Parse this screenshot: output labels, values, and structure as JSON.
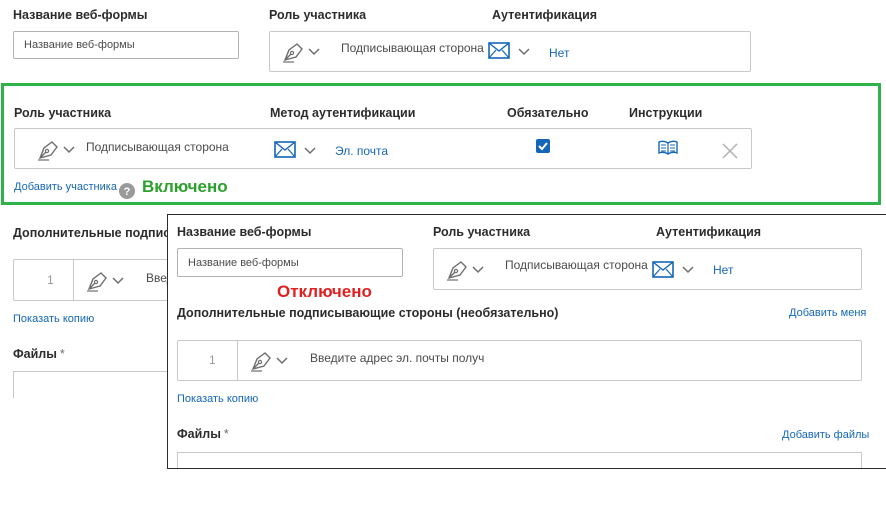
{
  "top": {
    "form_name_label": "Название веб-формы",
    "form_name_placeholder": "Название веб-формы",
    "role_label": "Роль участника",
    "auth_label": "Аутентификация",
    "role_value": "Подписывающая сторона",
    "auth_value": "Нет"
  },
  "enabled_panel": {
    "role_header": "Роль участника",
    "auth_method_header": "Метод аутентификации",
    "required_header": "Обязательно",
    "instructions_header": "Инструкции",
    "role_value": "Подписывающая сторона",
    "auth_value": "Эл. почта",
    "required_checked": true,
    "add_participant": "Добавить участника",
    "status_label": "Включено",
    "status_color": "#2ca02c",
    "border_color": "#2db34a"
  },
  "left_background": {
    "additional_signers_label": "Дополнительные подпис",
    "row_number": "1",
    "input_text": "Введ",
    "show_copy": "Показать копию",
    "files_label": "Файлы",
    "required_mark": "*"
  },
  "disabled_panel": {
    "form_name_label": "Название веб-формы",
    "form_name_placeholder": "Название веб-формы",
    "role_label": "Роль участника",
    "auth_label": "Аутентификация",
    "role_value": "Подписывающая сторона",
    "auth_value": "Нет",
    "status_label": "Отключено",
    "status_color": "#e02020",
    "additional_signers_label": "Дополнительные подписывающие стороны (необязательно)",
    "add_me": "Добавить меня",
    "row_number": "1",
    "email_placeholder": "Введите адрес эл. почты получ",
    "show_copy": "Показать копию",
    "files_label": "Файлы",
    "required_mark": "*",
    "add_files": "Добавить файлы"
  },
  "icons": {
    "pen": "pen-nib-icon",
    "chevron": "chevron-down-icon",
    "mail": "envelope-icon",
    "book": "open-book-icon",
    "close": "close-icon",
    "help": "help-icon",
    "check": "checkbox-icon"
  },
  "colors": {
    "link_blue": "#1466b8",
    "icon_blue": "#1466b8"
  }
}
